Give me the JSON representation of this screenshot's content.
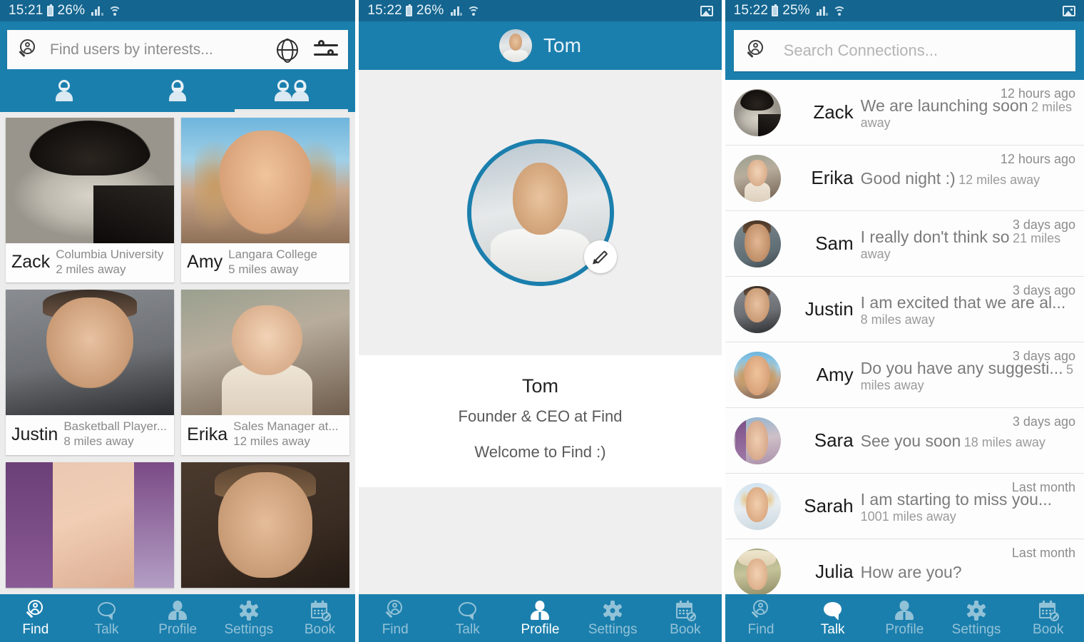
{
  "colors": {
    "statusbar_bg": "#14658f",
    "header_bg": "#1b7fad",
    "accent": "#1b7fad",
    "page_bg": "#ececec",
    "card_bg": "#fdfdfd"
  },
  "screen_find": {
    "status": {
      "time": "15:21",
      "battery": "26%",
      "signal_icon": "signal-bars-icon",
      "wifi_icon": "wifi-icon"
    },
    "search": {
      "placeholder": "Find users by interests...",
      "value": "",
      "search_icon": "search-person-icon",
      "globe_icon": "globe-icon",
      "filters_icon": "sliders-icon"
    },
    "tabs": [
      {
        "name": "men",
        "icon": "person-male-icon",
        "active": false
      },
      {
        "name": "women",
        "icon": "person-female-icon",
        "active": false
      },
      {
        "name": "everyone",
        "icon": "people-couple-icon",
        "active": true
      }
    ],
    "cards": [
      {
        "name": "Zack",
        "line1": "Columbia University",
        "line2": "2 miles away",
        "photo": "ph-zack"
      },
      {
        "name": "Amy",
        "line1": "Langara College",
        "line2": "5 miles away",
        "photo": "ph-amy"
      },
      {
        "name": "Justin",
        "line1": "Basketball Player...",
        "line2": "8 miles away",
        "photo": "ph-justin"
      },
      {
        "name": "Erika",
        "line1": "Sales Manager at...",
        "line2": "12 miles away",
        "photo": "ph-erika"
      },
      {
        "name": "",
        "line1": "",
        "line2": "",
        "photo": "ph-cora"
      },
      {
        "name": "",
        "line1": "",
        "line2": "",
        "photo": "ph-dan"
      }
    ],
    "nav": [
      {
        "label": "Find",
        "icon": "find-icon",
        "active": true
      },
      {
        "label": "Talk",
        "icon": "talk-icon",
        "active": false
      },
      {
        "label": "Profile",
        "icon": "profile-icon",
        "active": false
      },
      {
        "label": "Settings",
        "icon": "settings-gear-icon",
        "active": false
      },
      {
        "label": "Book",
        "icon": "calendar-book-icon",
        "active": false
      }
    ]
  },
  "screen_profile": {
    "status": {
      "time": "15:22",
      "battery": "26%",
      "gallery_icon": "gallery-icon"
    },
    "header": {
      "title": "Tom",
      "avatar_icon": "avatar"
    },
    "hero": {
      "edit_icon": "pencil-icon"
    },
    "details": {
      "name": "Tom",
      "role": "Founder & CEO at Find",
      "bio": "Welcome to Find :)"
    },
    "nav": [
      {
        "label": "Find",
        "icon": "find-icon",
        "active": false
      },
      {
        "label": "Talk",
        "icon": "talk-icon",
        "active": false
      },
      {
        "label": "Profile",
        "icon": "profile-icon",
        "active": true
      },
      {
        "label": "Settings",
        "icon": "settings-gear-icon",
        "active": false
      },
      {
        "label": "Book",
        "icon": "calendar-book-icon",
        "active": false
      }
    ]
  },
  "screen_talk": {
    "status": {
      "time": "15:22",
      "battery": "25%",
      "gallery_icon": "gallery-icon"
    },
    "search": {
      "placeholder": "Search Connections...",
      "value": "",
      "search_icon": "search-person-icon"
    },
    "chats": [
      {
        "name": "Zack",
        "message": "We are launching soon",
        "distance": "2 miles away",
        "time": "12 hours ago",
        "photo": "ph-zack"
      },
      {
        "name": "Erika",
        "message": "Good night :)",
        "distance": "12 miles away",
        "time": "12 hours ago",
        "photo": "ph-erika"
      },
      {
        "name": "Sam",
        "message": "I really don't think so",
        "distance": "21 miles away",
        "time": "3 days ago",
        "photo": "ph-sam"
      },
      {
        "name": "Justin",
        "message": "I am excited that we are al...",
        "distance": "8 miles away",
        "time": "3 days ago",
        "photo": "ph-justin"
      },
      {
        "name": "Amy",
        "message": "Do you have any suggesti...",
        "distance": "5 miles away",
        "time": "3 days ago",
        "photo": "ph-amy"
      },
      {
        "name": "Sara",
        "message": "See you soon",
        "distance": "18 miles away",
        "time": "3 days ago",
        "photo": "ph-sara"
      },
      {
        "name": "Sarah",
        "message": "I am starting to miss you...",
        "distance": "1001 miles away",
        "time": "Last month",
        "photo": "ph-sarah"
      },
      {
        "name": "Julia",
        "message": "How are you?",
        "distance": "",
        "time": "Last month",
        "photo": "ph-julia"
      }
    ],
    "nav": [
      {
        "label": "Find",
        "icon": "find-icon",
        "active": false
      },
      {
        "label": "Talk",
        "icon": "talk-icon",
        "active": true
      },
      {
        "label": "Profile",
        "icon": "profile-icon",
        "active": false
      },
      {
        "label": "Settings",
        "icon": "settings-gear-icon",
        "active": false
      },
      {
        "label": "Book",
        "icon": "calendar-book-icon",
        "active": false
      }
    ]
  }
}
